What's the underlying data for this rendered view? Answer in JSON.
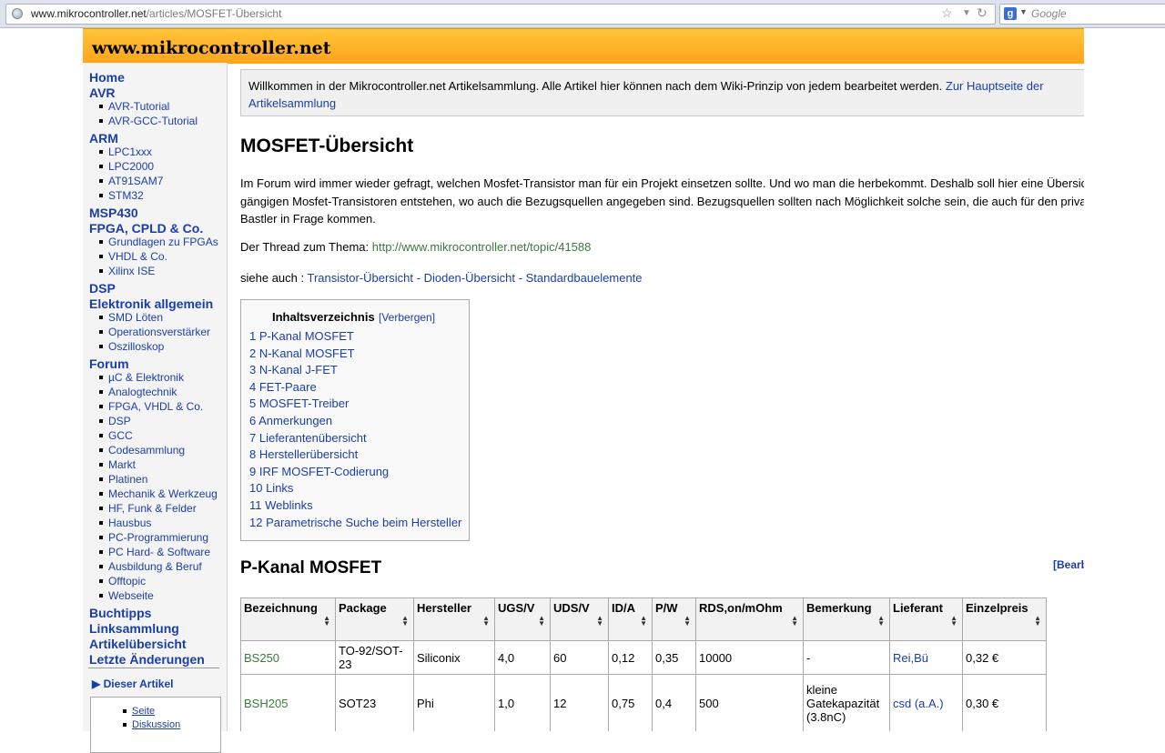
{
  "browser": {
    "url_host": "www.mikrocontroller.net",
    "url_path": "/articles/MOSFET-Übersicht",
    "search_placeholder": "Google",
    "search_engine_letter": "g"
  },
  "site": {
    "title": "www.mikrocontroller.net"
  },
  "sidebar": {
    "items": [
      {
        "type": "h",
        "label": "Home"
      },
      {
        "type": "h",
        "label": "AVR"
      },
      {
        "type": "i",
        "label": "AVR-Tutorial"
      },
      {
        "type": "i",
        "label": "AVR-GCC-Tutorial"
      },
      {
        "type": "h",
        "label": "ARM"
      },
      {
        "type": "i",
        "label": "LPC1xxx"
      },
      {
        "type": "i",
        "label": "LPC2000"
      },
      {
        "type": "i",
        "label": "AT91SAM7"
      },
      {
        "type": "i",
        "label": "STM32"
      },
      {
        "type": "h",
        "label": "MSP430"
      },
      {
        "type": "h",
        "label": "FPGA, CPLD & Co."
      },
      {
        "type": "i",
        "label": "Grundlagen zu FPGAs"
      },
      {
        "type": "i",
        "label": "VHDL & Co."
      },
      {
        "type": "i",
        "label": "Xilinx ISE"
      },
      {
        "type": "h",
        "label": "DSP"
      },
      {
        "type": "h",
        "label": "Elektronik allgemein"
      },
      {
        "type": "i",
        "label": "SMD Löten"
      },
      {
        "type": "i",
        "label": "Operationsverstärker"
      },
      {
        "type": "i",
        "label": "Oszilloskop"
      },
      {
        "type": "h",
        "label": "Forum"
      },
      {
        "type": "i",
        "label": "µC & Elektronik"
      },
      {
        "type": "i",
        "label": "Analogtechnik"
      },
      {
        "type": "i",
        "label": "FPGA, VHDL & Co."
      },
      {
        "type": "i",
        "label": "DSP"
      },
      {
        "type": "i",
        "label": "GCC"
      },
      {
        "type": "i",
        "label": "Codesammlung"
      },
      {
        "type": "i",
        "label": "Markt"
      },
      {
        "type": "i",
        "label": "Platinen"
      },
      {
        "type": "i",
        "label": "Mechanik & Werkzeug"
      },
      {
        "type": "i",
        "label": "HF, Funk & Felder"
      },
      {
        "type": "i",
        "label": "Hausbus"
      },
      {
        "type": "i",
        "label": "PC-Programmierung"
      },
      {
        "type": "i",
        "label": "PC Hard- & Software"
      },
      {
        "type": "i",
        "label": "Ausbildung & Beruf"
      },
      {
        "type": "i",
        "label": "Offtopic"
      },
      {
        "type": "i",
        "label": "Webseite"
      },
      {
        "type": "h",
        "label": "Buchtipps"
      },
      {
        "type": "h",
        "label": "Linksammlung"
      },
      {
        "type": "h",
        "label": "Artikelübersicht"
      },
      {
        "type": "h",
        "label": "Letzte Änderungen"
      }
    ],
    "article_toggle": "▶ Dieser Artikel",
    "article_links": [
      "Seite",
      "Diskussion"
    ]
  },
  "notice": {
    "text": "Willkommen in der Mikrocontroller.net Artikelsammlung. Alle Artikel hier können nach dem Wiki-Prinzip von jedem bearbeitet werden. ",
    "link": "Zur Hauptseite der Artikelsammlung"
  },
  "article": {
    "title": "MOSFET-Übersicht",
    "intro": "Im Forum wird immer wieder gefragt, welchen Mosfet-Transistor man für ein Projekt einsetzen sollte. Und wo man die herbekommt. Deshalb soll hier eine Übersicht mit gängigen Mosfet-Transistoren entstehen, wo auch die Bezugsquellen angegeben sind. Bezugsquellen sollten nach Möglichkeit solche sein, die auch für den privaten Bastler in Frage kommen.",
    "thread_label": "Der Thread zum Thema: ",
    "thread_link": "http://www.mikrocontroller.net/topic/41588",
    "see_also_label": "siehe auch : ",
    "see_also_links": [
      "Transistor-Übersicht",
      "Dioden-Übersicht",
      "Standardbauelemente"
    ],
    "see_also_sep": " - "
  },
  "toc": {
    "title": "Inhaltsverzeichnis",
    "hide": "[Verbergen]",
    "items": [
      "1 P-Kanal MOSFET",
      "2 N-Kanal MOSFET",
      "3 N-Kanal J-FET",
      "4 FET-Paare",
      "5 MOSFET-Treiber",
      "6 Anmerkungen",
      "7 Lieferantenübersicht",
      "8 Herstellerübersicht",
      "9 IRF MOSFET-Codierung",
      "10 Links",
      "11 Weblinks",
      "12 Parametrische Suche beim Hersteller"
    ]
  },
  "section": {
    "title": "P-Kanal MOSFET",
    "edit": "[Bearbeiten]"
  },
  "table": {
    "headers": [
      "Bezeichnung",
      "Package",
      "Hersteller",
      "UGS/V",
      "UDS/V",
      "ID/A",
      "P/W",
      "RDS,on/mOhm",
      "Bemerkung",
      "Lieferant",
      "Einzelpreis"
    ],
    "rows": [
      {
        "cells": [
          "BS250",
          "TO-92/SOT-23",
          "Siliconix",
          "4,0",
          "60",
          "0,12",
          "0,35",
          "10000",
          "-",
          "Rei,Bü",
          "0,32 €"
        ]
      },
      {
        "cells": [
          "BSH205",
          "SOT23",
          "Phi",
          "1,0",
          "12",
          "0,75",
          "0,4",
          "500",
          "kleine Gatekapazität (3.8nC)",
          "csd (a.A.)",
          "0,30 €"
        ]
      },
      {
        "cells": [
          "",
          "",
          "",
          "",
          "",
          "",
          "",
          "",
          "kleine",
          "",
          ""
        ]
      }
    ]
  }
}
